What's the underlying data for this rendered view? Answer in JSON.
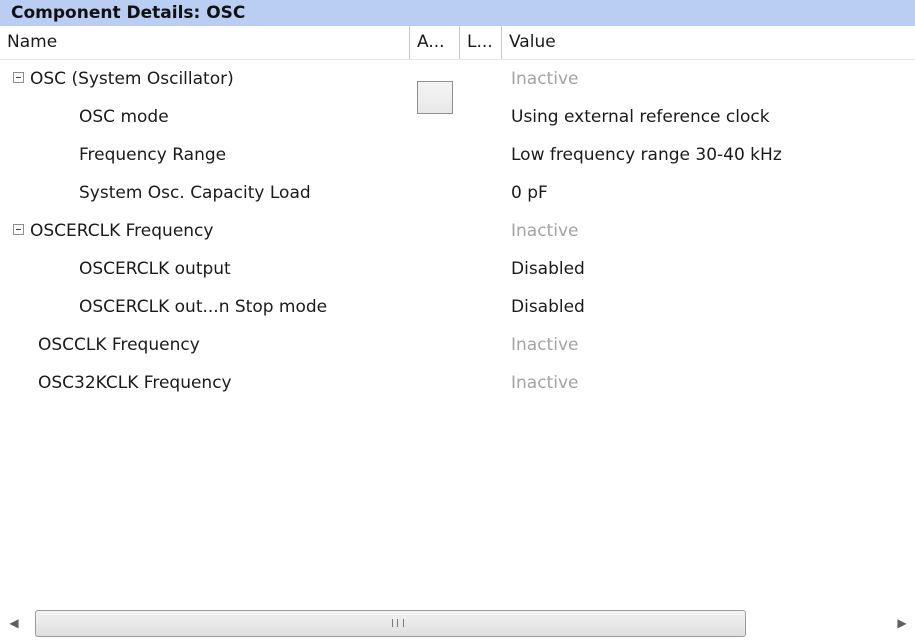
{
  "panel": {
    "title": "Component Details: OSC"
  },
  "columns": {
    "name": "Name",
    "a": "A...",
    "l": "L...",
    "value": "Value"
  },
  "rows": [
    {
      "name": "OSC (System Oscillator)",
      "value": "Inactive"
    },
    {
      "name": "OSC mode",
      "value": "Using external reference clock"
    },
    {
      "name": "Frequency Range",
      "value": "Low frequency range 30-40 kHz"
    },
    {
      "name": "System Osc. Capacity Load",
      "value": "0 pF"
    },
    {
      "name": "OSCERCLK Frequency",
      "value": "Inactive"
    },
    {
      "name": "OSCERCLK output",
      "value": "Disabled"
    },
    {
      "name": "OSCERCLK out...n Stop mode",
      "value": "Disabled"
    },
    {
      "name": "OSCCLK Frequency",
      "value": "Inactive"
    },
    {
      "name": "OSC32KCLK Frequency",
      "value": "Inactive"
    }
  ],
  "scrollbar": {
    "left_icon": "chevron-left-icon",
    "right_icon": "chevron-right-icon",
    "grip_icon": "grip-icon"
  },
  "colors": {
    "title_bar": "#b9cef2",
    "inactive_text": "#a3a3a3"
  }
}
